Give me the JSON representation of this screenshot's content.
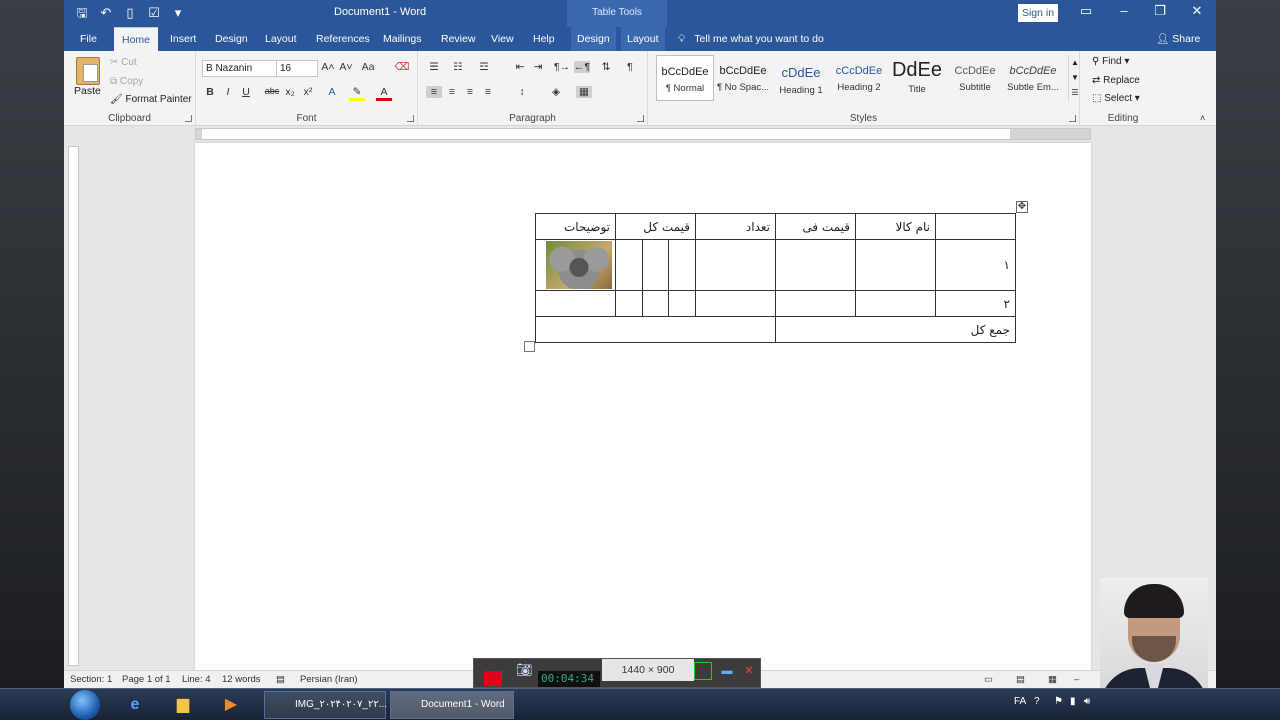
{
  "app": {
    "document_title": "Document1 - Word",
    "context_tab_group": "Table Tools",
    "sign_in": "Sign in",
    "share": "Share",
    "tell_me": "Tell me what you want to do"
  },
  "tabs": [
    "File",
    "Home",
    "Insert",
    "Design",
    "Layout",
    "References",
    "Mailings",
    "Review",
    "View",
    "Help",
    "Design",
    "Layout"
  ],
  "ribbon": {
    "clipboard": {
      "label": "Clipboard",
      "paste": "Paste",
      "cut": "Cut",
      "copy": "Copy",
      "format_painter": "Format Painter"
    },
    "font": {
      "label": "Font",
      "font_name": "B Nazanin",
      "font_size": "16"
    },
    "paragraph": {
      "label": "Paragraph"
    },
    "styles": {
      "label": "Styles",
      "items": [
        {
          "preview": "bCcDdEe",
          "name": "¶ Normal"
        },
        {
          "preview": "bCcDdEe",
          "name": "¶ No Spac..."
        },
        {
          "preview": "cDdEe",
          "name": "Heading 1"
        },
        {
          "preview": "cCcDdEe",
          "name": "Heading 2"
        },
        {
          "preview": "DdEe",
          "name": "Title"
        },
        {
          "preview": "CcDdEe",
          "name": "Subtitle"
        },
        {
          "preview": "bCcDdEe",
          "name": "Subtle Em..."
        }
      ]
    },
    "editing": {
      "label": "Editing",
      "find": "Find",
      "replace": "Replace",
      "select": "Select"
    }
  },
  "table": {
    "headers": [
      "",
      "نام کالا",
      "قیمت فی",
      "تعداد",
      "قیمت کل",
      "توضیحات"
    ],
    "row1": "۱",
    "row2": "۲",
    "total": "جمع کل"
  },
  "status": {
    "section": "Section: 1",
    "page": "Page 1 of 1",
    "line": "Line: 4",
    "words": "12 words",
    "language": "Persian (Iran)"
  },
  "recorder": {
    "resolution": "1440 × 900",
    "timer": "00:04:34"
  },
  "taskbar": {
    "tasks": [
      "IMG_۲۰۲۴۰۲۰۷_۲۲...",
      "Document1 - Word"
    ],
    "lang": "FA"
  }
}
